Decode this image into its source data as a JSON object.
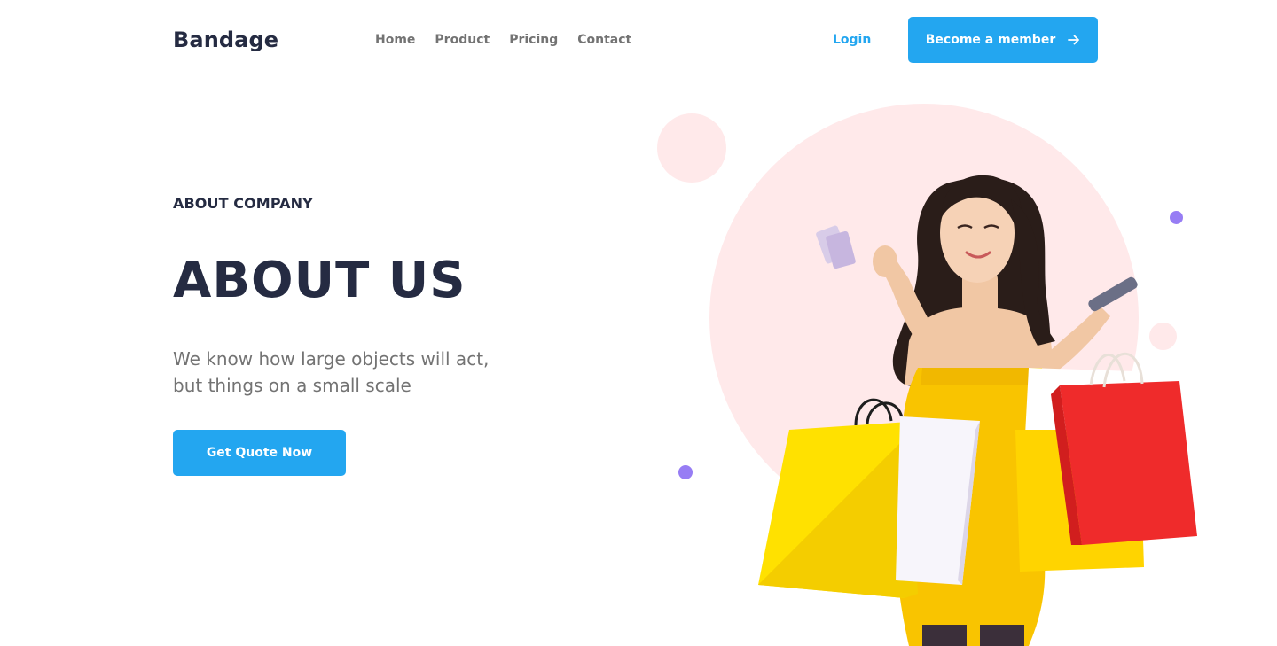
{
  "header": {
    "brand": "Bandage",
    "nav": [
      "Home",
      "Product",
      "Pricing",
      "Contact"
    ],
    "login_label": "Login",
    "member_button_label": "Become a member"
  },
  "hero": {
    "eyebrow": "ABOUT COMPANY",
    "title": "ABOUT US",
    "subtitle_line1": "We know how large objects will act,",
    "subtitle_line2": "but things on a small scale",
    "cta_label": "Get Quote Now"
  },
  "colors": {
    "primary": "#23A6F0",
    "heading": "#252B42",
    "muted": "#737373",
    "pink": "#FFE9EA",
    "purple": "#977DF4"
  },
  "icons": {
    "member_button": "arrow-right-icon"
  }
}
